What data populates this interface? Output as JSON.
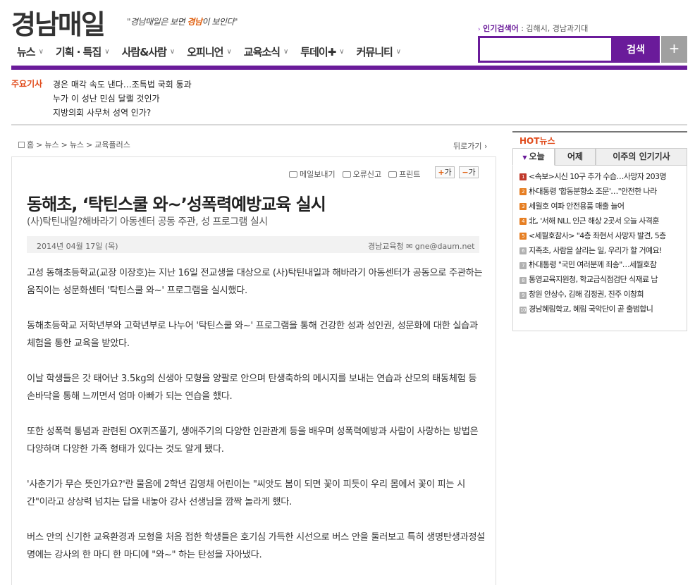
{
  "header": {
    "logo": "경남매일",
    "slogan_parts": [
      "\"경남매일",
      "은 보면 ",
      "경남",
      "이 보인다\""
    ],
    "popular_label": "인기검색어",
    "popular_terms": ": 김해시, 경남과기대"
  },
  "nav": {
    "items": [
      {
        "label": "뉴스"
      },
      {
        "label": "기획 · 특집"
      },
      {
        "label": "사람&사람"
      },
      {
        "label": "오피니언"
      },
      {
        "label": "교육소식"
      },
      {
        "label": "투데이✚"
      },
      {
        "label": "커뮤니티"
      }
    ]
  },
  "search": {
    "value": "",
    "placeholder": "",
    "button_label": "검색",
    "plus_label": "+"
  },
  "headlines": {
    "label": "주요기사",
    "items": [
      "경은 매각 속도 낸다…조특법 국회 통과",
      "누가 이 성난 민심 달랠 것인가",
      "지방의회 사무처 성역 인가?"
    ]
  },
  "breadcrumb": {
    "items": [
      "홈",
      ">",
      "뉴스",
      ">",
      "뉴스",
      ">",
      "교육플러스"
    ],
    "back": "뒤로가기 ›"
  },
  "tools": {
    "email": "메일보내기",
    "report": "오류신고",
    "print": "프린트",
    "font_plus": "가",
    "font_minus": "가",
    "font_plus_sign": "+",
    "font_minus_sign": "−"
  },
  "article": {
    "title": "동해초, ‘탁틴스쿨 와~’성폭력예방교육 실시",
    "subtitle": "(사)탁틴내일?해바라기 아동센터 공동 주관, 성 프로그램 실시",
    "date": "2014년  04월  17일  (목)",
    "source": "경남교육청  ✉ gne@daum.net",
    "paragraphs": [
      "고성 동해초등학교(교장 이장호)는 지난 16일 전교생을 대상으로 (사)탁틴내일과 해바라기 아동센터가 공동으로 주관하는 움직이는 성문화센터 '탁틴스쿨 와~' 프로그램을 실시했다.",
      "동해초등학교 저학년부와 고학년부로 나누어 '탁틴스쿨 와~' 프로그램을 통해 건강한 성과 성인권, 성문화에 대한 실습과 체험을 통한 교육을 받았다.",
      "이날 학생들은 갓 태어난 3.5kg의 신생아 모형을 양팔로 안으며 탄생축하의 메시지를 보내는 연습과 산모의 태동체험 등 손바닥을 통해 느끼면서 엄마 아빠가 되는 연습을 했다.",
      "또한 성폭력 통념과 관련된 OX퀴즈풀기, 생애주기의 다양한 인관관계 등을 배우며 성폭력예방과 사람이 사랑하는 방법은 다양하며 다양한 가족 형태가 있다는 것도 알게 됐다.",
      "'사춘기가 무슨 뜻인가요?'란 물음에 2학년 김영채 어린이는 \"씨앗도 봄이 되면 꽃이 피듯이 우리 몸에서 꽃이 피는 시간\"이라고 상상력 넘치는 답을 내놓아 강사 선생님을 깜짝 놀라게 했다.",
      "버스 안의 신기한 교육환경과 모형을 처음 접한 학생들은 호기심 가득한 시선으로 버스 안을 둘러보고 특히 생명탄생과정설명에는 강사의 한 마디 한 마디에 \"와~\" 하는 탄성을 자아냈다."
    ]
  },
  "hot": {
    "title": "HOT뉴스",
    "tabs": [
      "오늘",
      "어제",
      "이주의 인기기사"
    ],
    "items": [
      {
        "rank": "1",
        "text": "<속보>시신 10구 추가 수습…사망자 203명"
      },
      {
        "rank": "2",
        "text": "朴대통령 '합동분향소 조문'…\"안전한 나라"
      },
      {
        "rank": "3",
        "text": "세월호 여파 안전용품 매출 늘어"
      },
      {
        "rank": "4",
        "text": "北, '서해 NLL 인근 해상 2곳서 오늘 사격훈"
      },
      {
        "rank": "5",
        "text": "<세월호참사> \"4층 좌현서 사망자 발견, 5층"
      },
      {
        "rank": "6",
        "text": "지족초, 사람을 살리는 일, 우리가 할 거예요!"
      },
      {
        "rank": "7",
        "text": "朴대통령 \"국민 여러분께 죄송\"…세월호참"
      },
      {
        "rank": "8",
        "text": "통영교육지원청, 학교급식점검단 식재료 납"
      },
      {
        "rank": "9",
        "text": "창원 안상수, 김해 김정권, 진주 이창희"
      },
      {
        "rank": "10",
        "text": "경남혜림학교, 혜림 국악단이 곧 출범합니"
      }
    ],
    "colors": {
      "top": "#c0392b",
      "mid": "#e67e22",
      "low": "#b0b0b0"
    }
  }
}
